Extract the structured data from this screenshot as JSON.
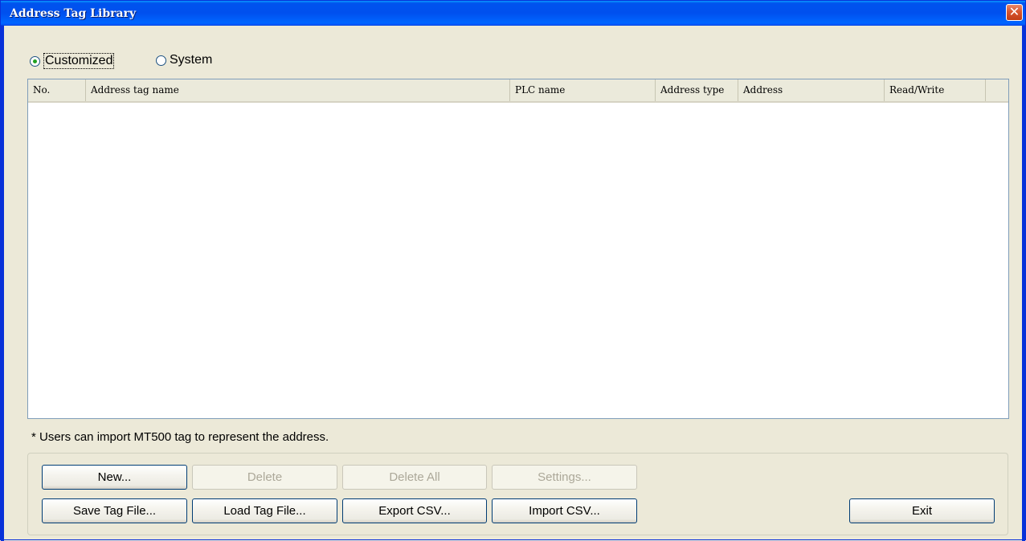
{
  "window": {
    "title": "Address Tag Library",
    "close_glyph": "✕"
  },
  "radio": {
    "customized": {
      "label": "Customized",
      "selected": true
    },
    "system": {
      "label": "System",
      "selected": false
    }
  },
  "table": {
    "columns": [
      "No.",
      "Address tag name",
      "PLC name",
      "Address type",
      "Address",
      "Read/Write"
    ],
    "rows": []
  },
  "note": "* Users can import MT500 tag to represent the address.",
  "buttons": {
    "new": "New...",
    "delete": "Delete",
    "delete_all": "Delete All",
    "settings": "Settings...",
    "save_tag_file": "Save Tag File...",
    "load_tag_file": "Load Tag File...",
    "export_csv": "Export CSV...",
    "import_csv": "Import CSV...",
    "exit": "Exit"
  },
  "colors": {
    "titlebar": "#0054e3",
    "face": "#ece9d8",
    "close": "#d8562f"
  }
}
